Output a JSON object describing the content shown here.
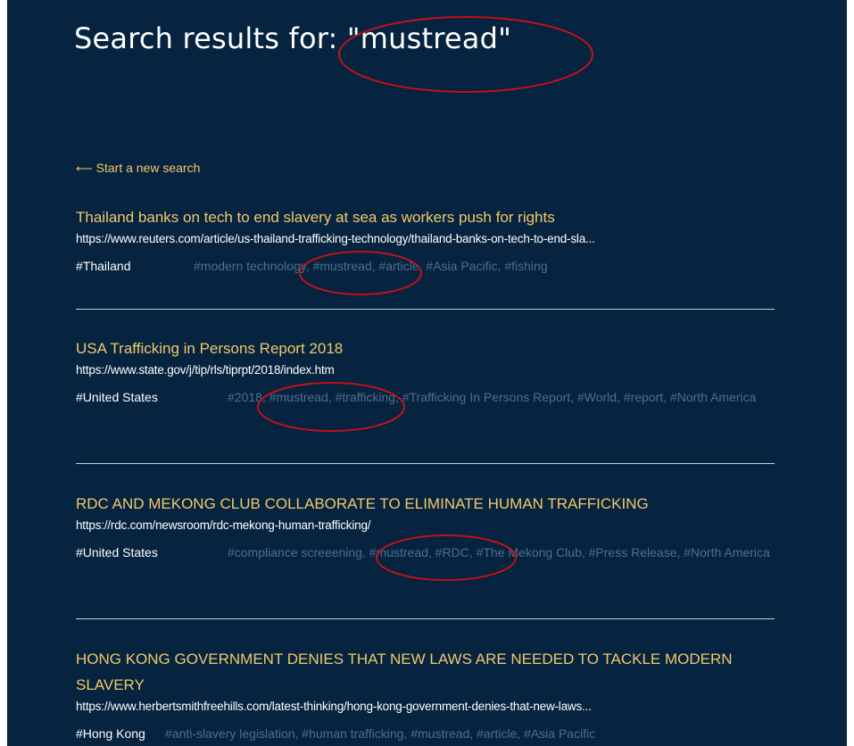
{
  "page": {
    "title": "Search results for: \"mustread\"",
    "back_link": "Start a new search"
  },
  "results": [
    {
      "title": "Thailand banks on tech to end slavery at sea as workers push for rights",
      "url": "https://www.reuters.com/article/us-thailand-trafficking-technology/thailand-banks-on-tech-to-end-sla...",
      "region": "#Thailand",
      "tags": "#modern technology, #mustread, #article, #Asia Pacific, #fishing"
    },
    {
      "title": "USA Trafficking in Persons Report 2018",
      "url": "https://www.state.gov/j/tip/rls/tiprpt/2018/index.htm",
      "region": "#United States",
      "tags": "#2018, #mustread, #trafficking, #Trafficking In Persons Report, #World, #report, #North America"
    },
    {
      "title": "RDC AND MEKONG CLUB COLLABORATE TO ELIMINATE HUMAN TRAFFICKING",
      "url": "https://rdc.com/newsroom/rdc-mekong-human-trafficking/",
      "region": "#United States",
      "tags": "#compliance screeening, #mustread, #RDC, #The Mekong Club, #Press Release, #North America"
    },
    {
      "title": "HONG KONG GOVERNMENT DENIES THAT NEW LAWS ARE NEEDED TO TACKLE MODERN SLAVERY",
      "url": "https://www.herbertsmithfreehills.com/latest-thinking/hong-kong-government-denies-that-new-laws...",
      "region": "#Hong Kong",
      "tags": "#anti-slavery legislation, #human trafficking, #mustread, #article, #Asia Pacific"
    }
  ],
  "colors": {
    "background": "#06233f",
    "title_text": "#f2c86b",
    "tag_text": "#4f6f90",
    "annotation": "#c0121a"
  },
  "icons": {
    "back": "arrow-left-icon"
  }
}
